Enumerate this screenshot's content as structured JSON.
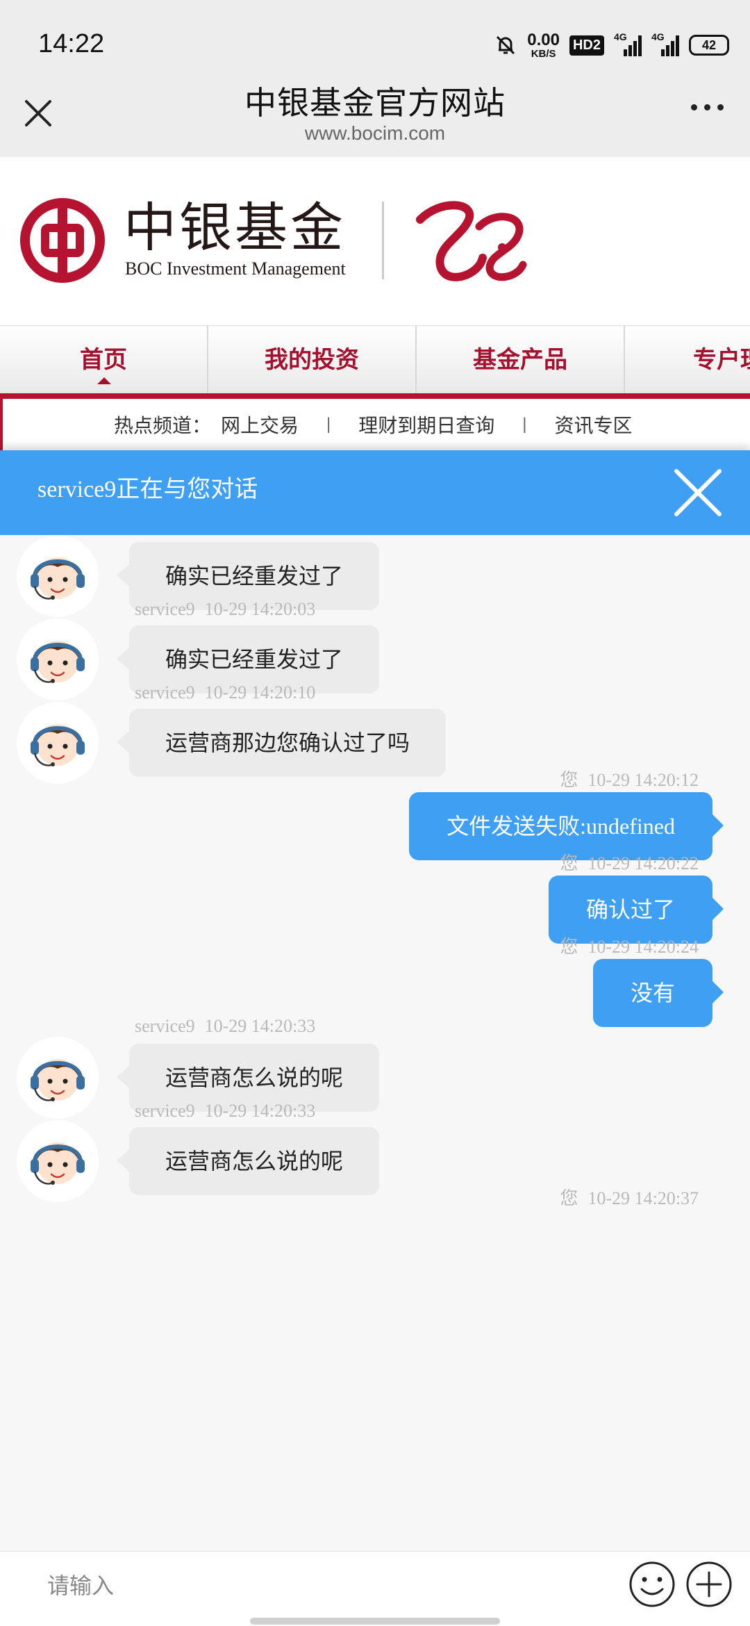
{
  "status_bar": {
    "time": "14:22",
    "net_speed_value": "0.00",
    "net_speed_unit": "KB/S",
    "hd_label": "HD2",
    "signal1_label": "4G",
    "signal2_label": "4G",
    "battery": "42"
  },
  "title_bar": {
    "title": "中银基金官方网站",
    "url": "www.bocim.com"
  },
  "site_header": {
    "logo_cn": "中银基金",
    "logo_en": "BOC Investment Management",
    "brand_color": "#b5132f"
  },
  "nav": {
    "items": [
      {
        "label": "首页"
      },
      {
        "label": "我的投资"
      },
      {
        "label": "基金产品"
      },
      {
        "label": "专户理"
      }
    ]
  },
  "hot_bar": {
    "label": "热点频道：",
    "links": [
      "网上交易",
      "理财到期日查询",
      "资讯专区"
    ],
    "separator": "|"
  },
  "chat": {
    "header_title": "service9正在与您对话",
    "header_color": "#3fa0f3",
    "messages": [
      {
        "side": "left",
        "text": "确实已经重发过了"
      },
      {
        "side": "meta-left",
        "sender": "service9",
        "time": "10-29 14:20:03"
      },
      {
        "side": "left",
        "text": "确实已经重发过了"
      },
      {
        "side": "meta-left",
        "sender": "service9",
        "time": "10-29 14:20:10"
      },
      {
        "side": "left",
        "text": "运营商那边您确认过了吗"
      },
      {
        "side": "meta-right",
        "sender": "您",
        "time": "10-29 14:20:12"
      },
      {
        "side": "right",
        "text": "文件发送失败:undefined"
      },
      {
        "side": "meta-right",
        "sender": "您",
        "time": "10-29 14:20:22"
      },
      {
        "side": "right",
        "text": "确认过了"
      },
      {
        "side": "meta-right",
        "sender": "您",
        "time": "10-29 14:20:24"
      },
      {
        "side": "right",
        "text": "没有"
      },
      {
        "side": "meta-left",
        "sender": "service9",
        "time": "10-29 14:20:33"
      },
      {
        "side": "left",
        "text": "运营商怎么说的呢"
      },
      {
        "side": "meta-left",
        "sender": "service9",
        "time": "10-29 14:20:33"
      },
      {
        "side": "left",
        "text": "运营商怎么说的呢"
      },
      {
        "side": "meta-right",
        "sender": "您",
        "time": "10-29 14:20:37"
      }
    ]
  },
  "input_bar": {
    "placeholder": "请输入",
    "emoji_icon": "smiley-icon",
    "plus_icon": "plus-icon"
  }
}
